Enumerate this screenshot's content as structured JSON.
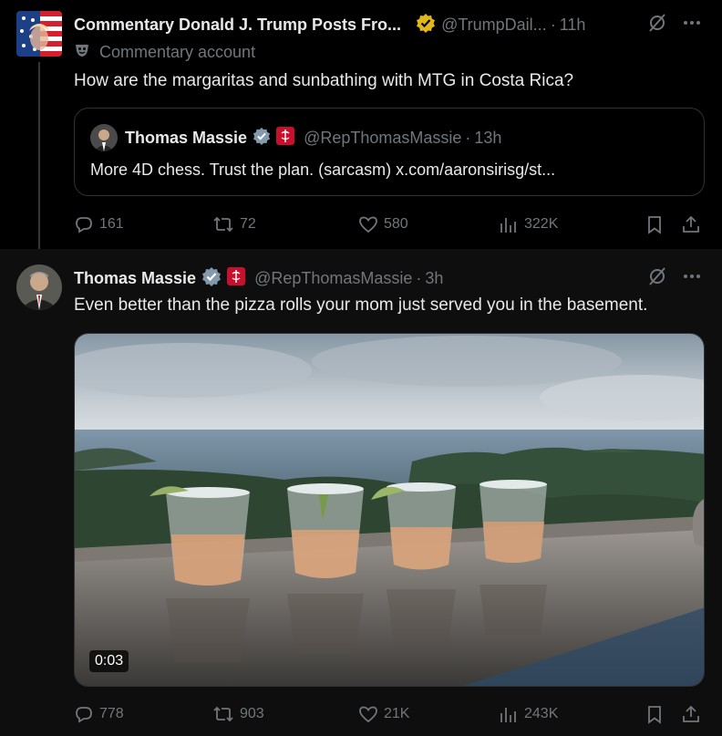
{
  "tweet1": {
    "name": "Commentary Donald J. Trump Posts Fro...",
    "handle": "@TrumpDail...",
    "time": "11h",
    "label": "Commentary account",
    "text": "How are the margaritas and sunbathing with MTG in Costa Rica?",
    "quote": {
      "name": "Thomas Massie",
      "handle": "@RepThomasMassie",
      "time": "13h",
      "text": "More 4D chess. Trust the plan. (sarcasm) x.com/aaronsirisg/st..."
    },
    "actions": {
      "replies": "161",
      "reposts": "72",
      "likes": "580",
      "views": "322K"
    }
  },
  "tweet2": {
    "name": "Thomas Massie",
    "handle": "@RepThomasMassie",
    "time": "3h",
    "text": "Even better than the pizza rolls your mom just served you in the basement.",
    "video_time": "0:03",
    "actions": {
      "replies": "778",
      "reposts": "903",
      "likes": "21K",
      "views": "243K"
    }
  },
  "colors": {
    "verified_gold": "#e2b719",
    "verified_gray": "#829aab",
    "muted": "#71767b",
    "border": "#2f3336"
  },
  "icons": [
    "grok-icon",
    "more-icon",
    "reply-icon",
    "repost-icon",
    "like-icon",
    "views-icon",
    "bookmark-icon",
    "share-icon",
    "parody-mask-icon",
    "house-seal-icon"
  ]
}
